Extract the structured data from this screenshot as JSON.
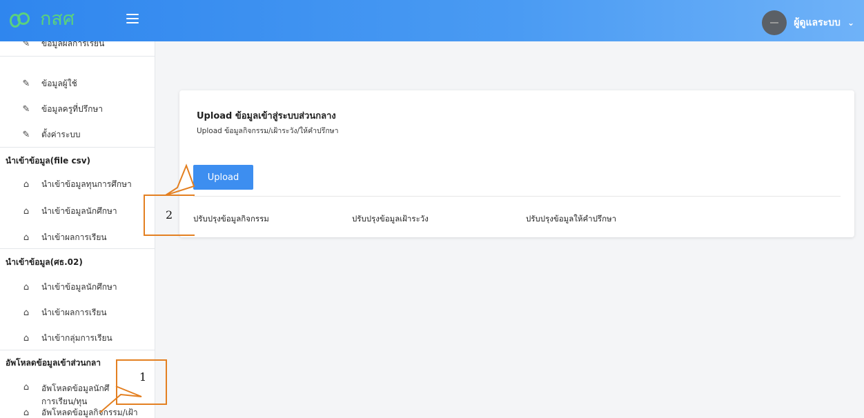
{
  "header": {
    "logo_text": "กสศ",
    "user_name": "ผู้ดูแลระบบ",
    "chevron": "⌄",
    "brand_color": "#5bd17d",
    "bar_color": "#3d8ef0"
  },
  "sidebar": {
    "top_item": "ข้อมูลผลการเรียน",
    "items_admin": [
      {
        "label": "ข้อมูลผู้ใช้",
        "icon": "edit-icon"
      },
      {
        "label": "ข้อมูลครูที่ปรึกษา",
        "icon": "edit-icon"
      },
      {
        "label": "ตั้งค่าระบบ",
        "icon": "edit-icon"
      }
    ],
    "section_csv": "นำเข้าข้อมูล(file csv)",
    "items_csv": [
      {
        "label": "นำเข้าข้อมูลทุนการศึกษา",
        "icon": "cloud-upload-icon"
      },
      {
        "label": "นำเข้าข้อมูลนักศึกษา",
        "icon": "cloud-upload-icon"
      },
      {
        "label": "นำเข้าผลการเรียน",
        "icon": "cloud-upload-icon"
      }
    ],
    "section_sor": "นำเข้าข้อมูล(ศธ.02)",
    "items_sor": [
      {
        "label": "นำเข้าข้อมูลนักศึกษา",
        "icon": "cloud-upload-icon"
      },
      {
        "label": "นำเข้าผลการเรียน",
        "icon": "cloud-upload-icon"
      },
      {
        "label": "นำเข้ากลุ่มการเรียน",
        "icon": "cloud-upload-icon"
      }
    ],
    "section_upload": "อัพโหลดข้อมูลเข้าส่วนกลา",
    "items_upload": [
      {
        "label": "อัพโหลดข้อมูลนักศึ",
        "label2": "การเรียน/ทุน",
        "icon": "cloud-upload-icon"
      },
      {
        "label": "อัพโหลดข้อมูลกิจกรรม/เฝ้า",
        "icon": "cloud-upload-icon"
      }
    ]
  },
  "main": {
    "title": "Upload ข้อมูลเข้าสู่ระบบส่วนกลาง",
    "subtitle": "Upload ข้อมูลกิจกรรม/เฝ้าระวัง/ให้คำปรึกษา",
    "upload_label": "Upload",
    "links": [
      "ปรับปรุงข้อมูลกิจกรรม",
      "ปรับปรุงข้อมูลเฝ้าระวัง",
      "ปรับปรุงข้อมูลให้คำปรึกษา"
    ]
  },
  "annotations": {
    "callout_1": "1",
    "callout_2": "2",
    "color": "#e37f20"
  }
}
